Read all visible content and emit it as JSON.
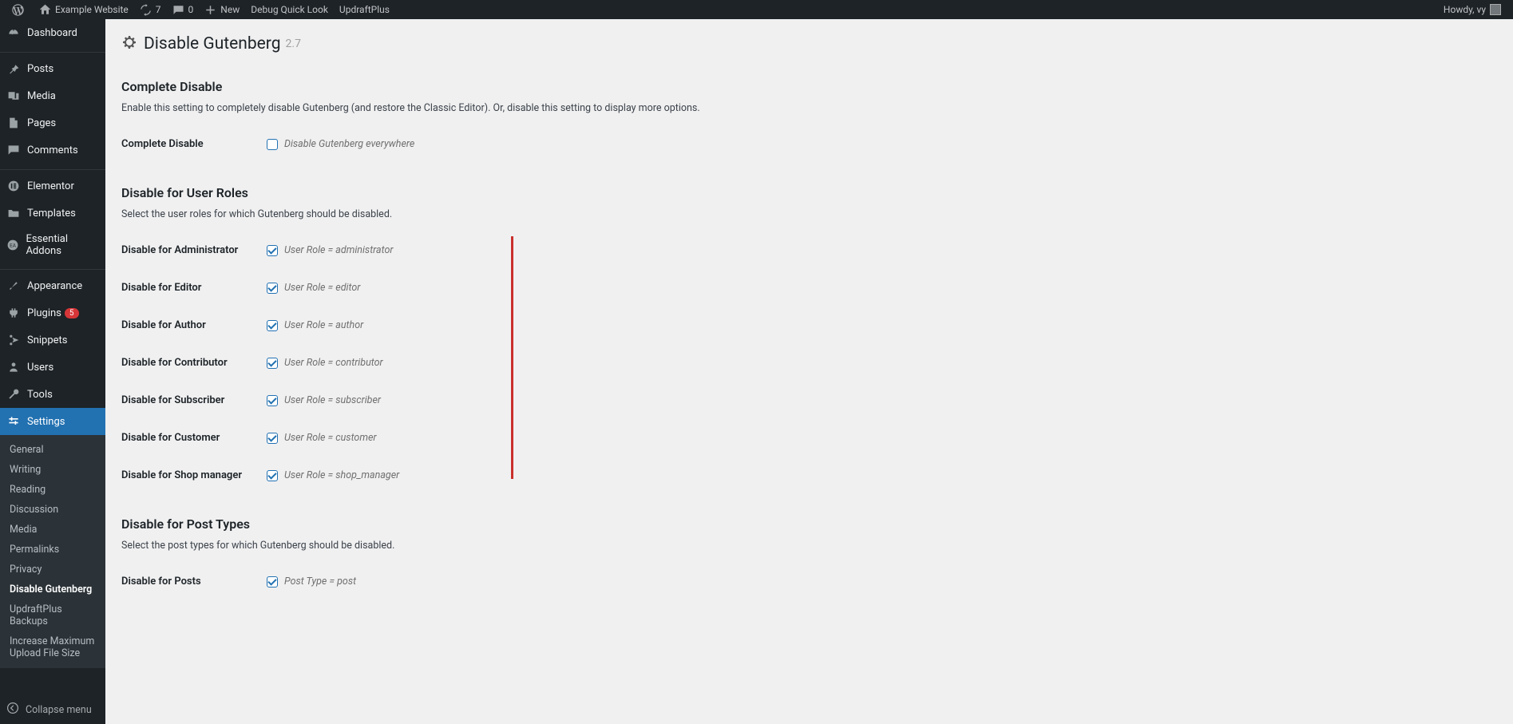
{
  "adminbar": {
    "site_name": "Example Website",
    "updates": "7",
    "comments": "0",
    "new_label": "New",
    "items": [
      "Debug Quick Look",
      "UpdraftPlus"
    ],
    "howdy": "Howdy, vy"
  },
  "sidebar": {
    "items": [
      {
        "label": "Dashboard"
      },
      {
        "label": "Posts"
      },
      {
        "label": "Media"
      },
      {
        "label": "Pages"
      },
      {
        "label": "Comments"
      },
      {
        "label": "Elementor"
      },
      {
        "label": "Templates"
      },
      {
        "label": "Essential Addons"
      },
      {
        "label": "Appearance"
      },
      {
        "label": "Plugins",
        "badge": "5"
      },
      {
        "label": "Snippets"
      },
      {
        "label": "Users"
      },
      {
        "label": "Tools"
      },
      {
        "label": "Settings"
      }
    ],
    "submenu": [
      "General",
      "Writing",
      "Reading",
      "Discussion",
      "Media",
      "Permalinks",
      "Privacy",
      "Disable Gutenberg",
      "UpdraftPlus Backups",
      "Increase Maximum Upload File Size"
    ],
    "collapse": "Collapse menu"
  },
  "page": {
    "title": "Disable Gutenberg",
    "version": "2.7",
    "section1": {
      "heading": "Complete Disable",
      "desc": "Enable this setting to completely disable Gutenberg (and restore the Classic Editor). Or, disable this setting to display more options.",
      "row_label": "Complete Disable",
      "row_hint": "Disable Gutenberg everywhere"
    },
    "section2": {
      "heading": "Disable for User Roles",
      "desc": "Select the user roles for which Gutenberg should be disabled.",
      "rows": [
        {
          "label": "Disable for Administrator",
          "hint": "User Role = administrator"
        },
        {
          "label": "Disable for Editor",
          "hint": "User Role = editor"
        },
        {
          "label": "Disable for Author",
          "hint": "User Role = author"
        },
        {
          "label": "Disable for Contributor",
          "hint": "User Role = contributor"
        },
        {
          "label": "Disable for Subscriber",
          "hint": "User Role = subscriber"
        },
        {
          "label": "Disable for Customer",
          "hint": "User Role = customer"
        },
        {
          "label": "Disable for Shop manager",
          "hint": "User Role = shop_manager"
        }
      ]
    },
    "section3": {
      "heading": "Disable for Post Types",
      "desc": "Select the post types for which Gutenberg should be disabled.",
      "rows": [
        {
          "label": "Disable for Posts",
          "hint": "Post Type = post"
        }
      ]
    }
  }
}
